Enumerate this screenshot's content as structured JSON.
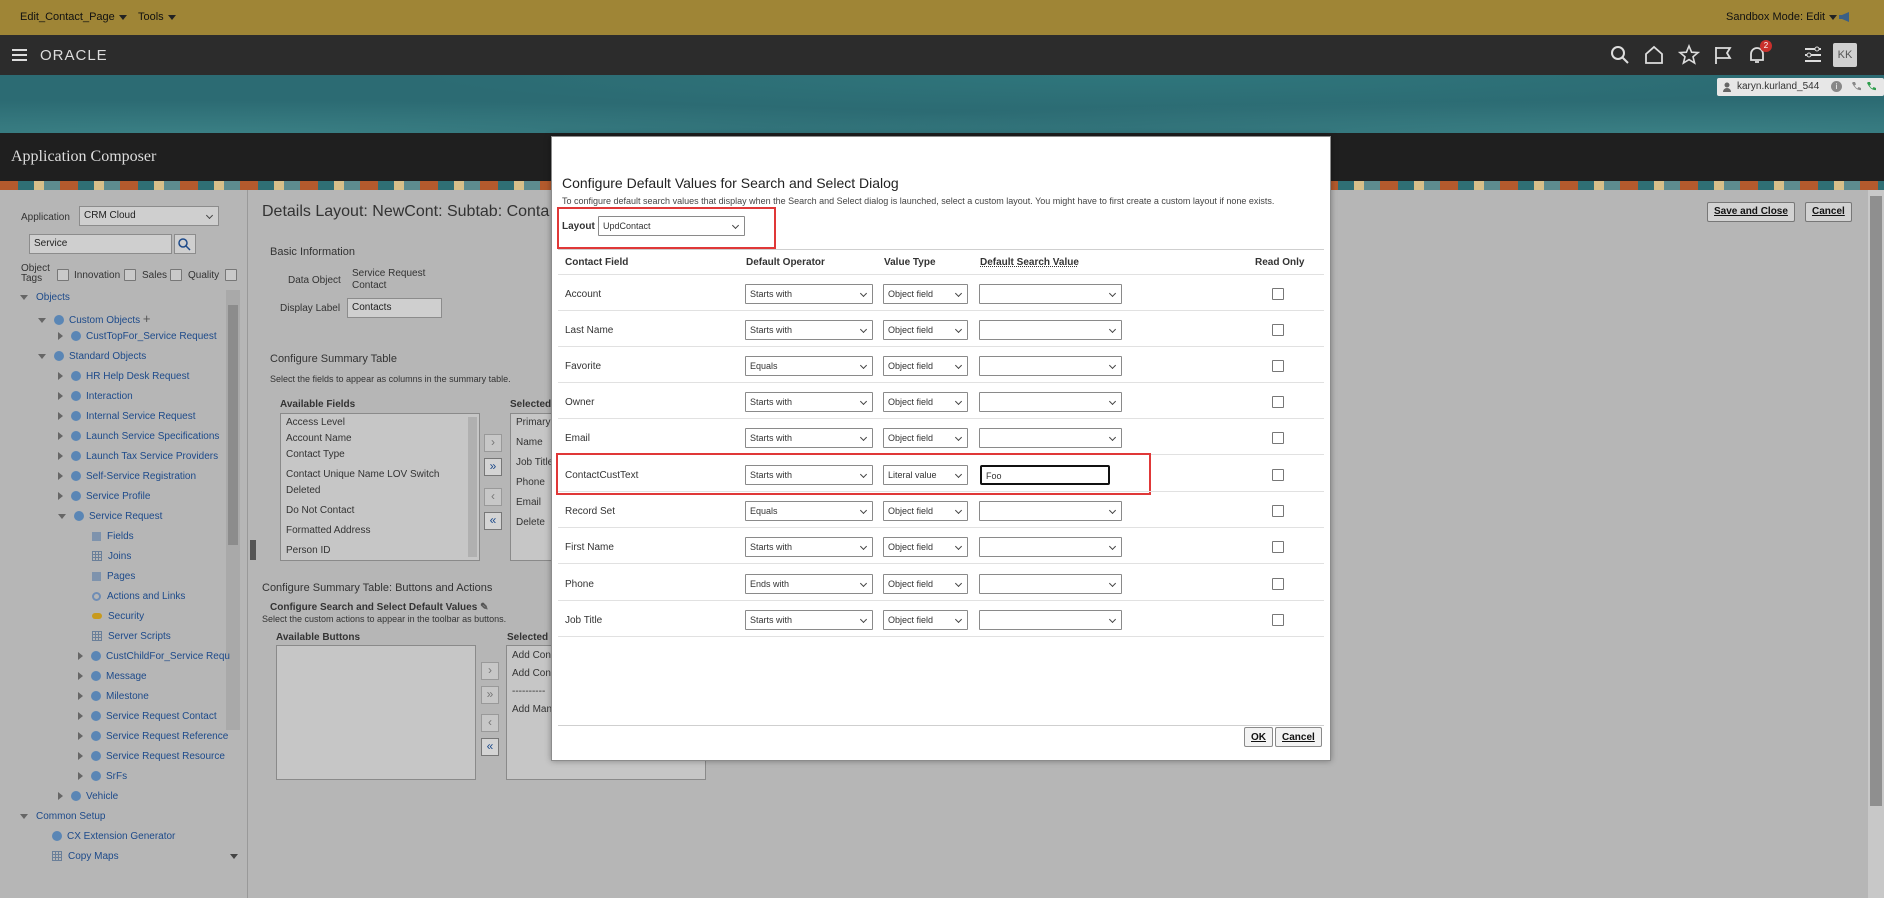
{
  "sandbox_bar": {
    "menu1": "Edit_Contact_Page",
    "menu2": "Tools",
    "mode": "Sandbox Mode: Edit"
  },
  "header": {
    "logo": "ORACLE",
    "notifications_count": "2",
    "avatar": "KK",
    "user": "karyn.kurland_544"
  },
  "app_title": "Application Composer",
  "left_nav": {
    "application_label": "Application",
    "application_value": "CRM Cloud",
    "search_value": "Service",
    "object_tags_label": "Object Tags",
    "tags": [
      "Innovation",
      "Sales",
      "Quality"
    ],
    "objects_label": "Objects",
    "custom_objects": "Custom Objects",
    "cust_top": "CustTopFor_Service Request",
    "standard_objects": "Standard Objects",
    "std_items": [
      "HR Help Desk Request",
      "Interaction",
      "Internal Service Request",
      "Launch Service Specifications",
      "Launch Tax Service Providers",
      "Self-Service Registration",
      "Service Profile",
      "Service Request"
    ],
    "sr_children": [
      "Fields",
      "Joins",
      "Pages",
      "Actions and Links",
      "Security",
      "Server Scripts"
    ],
    "sr_more": [
      "CustChildFor_Service Requ",
      "Message",
      "Milestone",
      "Service Request Contact",
      "Service Request Reference",
      "Service Request Resource",
      "SrFs"
    ],
    "vehicle": "Vehicle",
    "common_setup": "Common Setup",
    "cx_ext": "CX Extension Generator",
    "copy_maps": "Copy Maps"
  },
  "main": {
    "title": "Details Layout: NewCont: Subtab: Conta",
    "save_close": "Save and Close",
    "cancel": "Cancel",
    "basic_info": "Basic Information",
    "data_object_label": "Data Object",
    "data_object_value1": "Service Request",
    "data_object_value2": "Contact",
    "display_label_label": "Display Label",
    "display_label_value": "Contacts",
    "configure_summary": "Configure Summary Table",
    "configure_summary_desc": "Select the fields to appear as columns in the summary table.",
    "available_fields": "Available Fields",
    "selected_fields": "Selected",
    "available_list": [
      "Access Level",
      "Account Name",
      "Contact Type",
      "Contact Unique Name LOV Switch",
      "Deleted",
      "Do Not Contact",
      "Formatted Address",
      "Person ID"
    ],
    "selected_list": [
      "Primary",
      "Name",
      "Job Title",
      "Phone",
      "Email",
      "Delete"
    ],
    "buttons_actions": "Configure Summary Table: Buttons and Actions",
    "search_select_defaults": "Configure Search and Select Default Values",
    "custom_actions_desc": "Select the custom actions to appear in the toolbar as buttons.",
    "available_buttons": "Available Buttons",
    "selected_buttons": "Selected B",
    "selected_buttons_list": [
      "Add Con",
      "Add Con",
      "----------",
      "Add Man"
    ]
  },
  "dialog": {
    "title": "Configure Default Values for Search and Select Dialog",
    "description": "To configure default search values that display when the Search and Select dialog is launched, select a custom layout. You might have to first create a custom layout if none exists.",
    "layout_label": "Layout",
    "layout_value": "UpdContact",
    "columns": [
      "Contact Field",
      "Default Operator",
      "Value Type",
      "Default Search Value",
      "Read Only"
    ],
    "rows": [
      {
        "field": "Account",
        "operator": "Starts with",
        "value_type": "Object field",
        "search_value": ""
      },
      {
        "field": "Last Name",
        "operator": "Starts with",
        "value_type": "Object field",
        "search_value": ""
      },
      {
        "field": "Favorite",
        "operator": "Equals",
        "value_type": "Object field",
        "search_value": ""
      },
      {
        "field": "Owner",
        "operator": "Starts with",
        "value_type": "Object field",
        "search_value": ""
      },
      {
        "field": "Email",
        "operator": "Starts with",
        "value_type": "Object field",
        "search_value": ""
      },
      {
        "field": "ContactCustText",
        "operator": "Starts with",
        "value_type": "Literal value",
        "search_value": "Foo"
      },
      {
        "field": "Record Set",
        "operator": "Equals",
        "value_type": "Object field",
        "search_value": ""
      },
      {
        "field": "First Name",
        "operator": "Starts with",
        "value_type": "Object field",
        "search_value": ""
      },
      {
        "field": "Phone",
        "operator": "Ends with",
        "value_type": "Object field",
        "search_value": ""
      },
      {
        "field": "Job Title",
        "operator": "Starts with",
        "value_type": "Object field",
        "search_value": ""
      }
    ],
    "ok": "OK",
    "cancel": "Cancel"
  },
  "colors": {
    "sandbox_bar": "#9f8536",
    "header": "#2c2c2c",
    "highlight": "#e03838"
  }
}
